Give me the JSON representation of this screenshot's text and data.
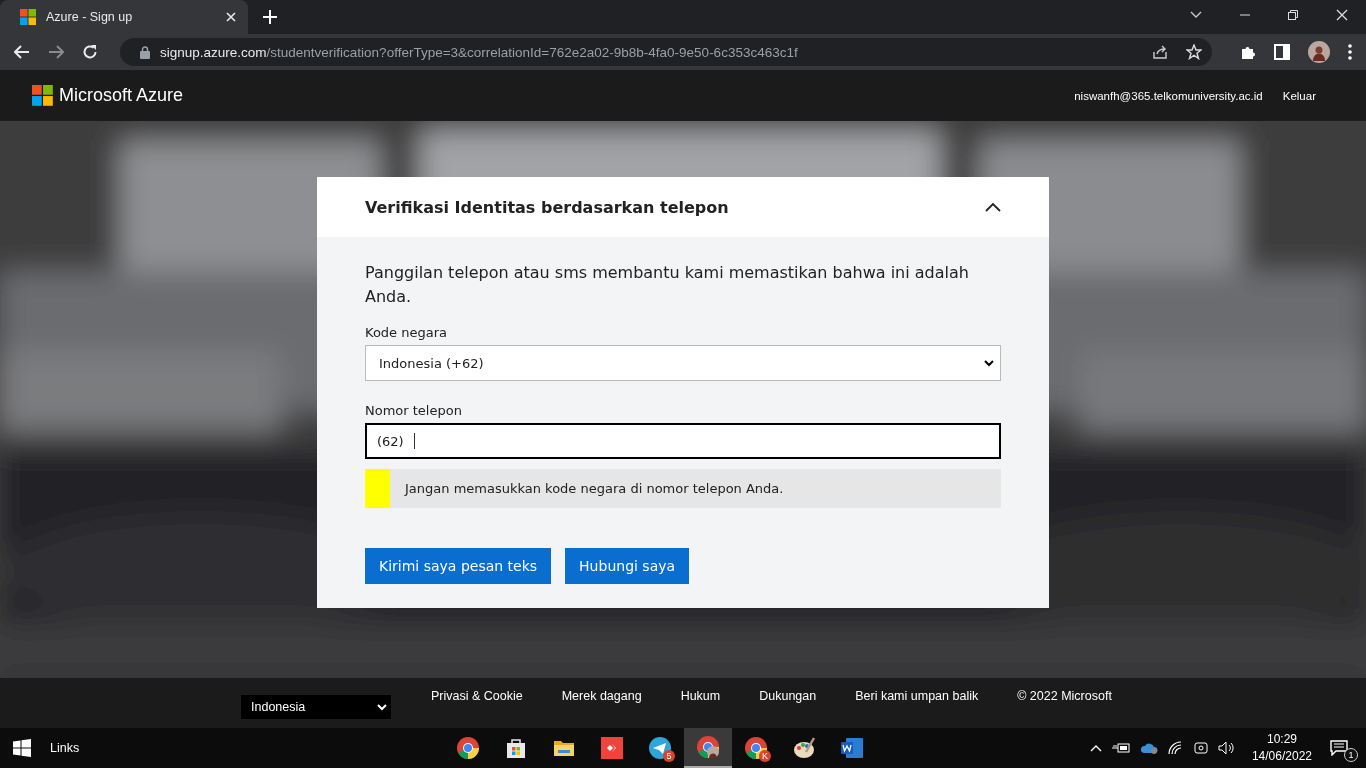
{
  "browser": {
    "tab": {
      "title": "Azure - Sign up",
      "selected": true
    },
    "url": {
      "host": "signup.azure.com",
      "path": "/studentverification?offerType=3&correlationId=762e2a02-9b8b-4fa0-9e50-6c353c463c1f"
    }
  },
  "header": {
    "brand": "Microsoft Azure",
    "user": "niswanfh@365.telkomuniversity.ac.id",
    "sign_out": "Keluar"
  },
  "card": {
    "title": "Verifikasi Identitas berdasarkan telepon",
    "expanded": true,
    "intro": "Panggilan telepon atau sms membantu kami memastikan bahwa ini adalah Anda.",
    "country_label": "Kode negara",
    "country_value": "Indonesia (+62)",
    "phone_label": "Nomor telepon",
    "phone_prefix": "(62)",
    "hint": {
      "text": "Jangan memasukkan kode negara di nomor telepon Anda.",
      "color": "#ffff00"
    },
    "buttons": [
      "Kirimi saya pesan teks",
      "Hubungi saya"
    ]
  },
  "footer": {
    "language": "Indonesia",
    "links": [
      "Privasi & Cookie",
      "Merek dagang",
      "Hukum",
      "Dukungan",
      "Beri kami umpan balik"
    ],
    "copyright": "© 2022 Microsoft"
  },
  "taskbar": {
    "toolbar_label": "Links",
    "apps": [
      {
        "kind": "chrome",
        "selected": false
      },
      {
        "kind": "store",
        "selected": false
      },
      {
        "kind": "folder",
        "selected": false
      },
      {
        "kind": "remote",
        "selected": false
      },
      {
        "kind": "telegram",
        "badge": "5",
        "selected": false
      },
      {
        "kind": "chrome-profile",
        "selected": true
      },
      {
        "kind": "chrome",
        "badge": "K",
        "selected": false
      },
      {
        "kind": "paint",
        "selected": false
      },
      {
        "kind": "word",
        "selected": false
      }
    ],
    "time": "10:29",
    "date": "14/06/2022",
    "notifications": "1"
  }
}
